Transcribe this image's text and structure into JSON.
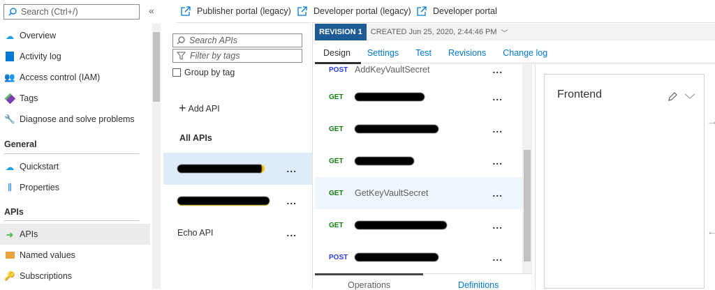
{
  "sidebar": {
    "search_placeholder": "Search (Ctrl+/)",
    "collapse": "«",
    "items": [
      {
        "label": "Overview"
      },
      {
        "label": "Activity log"
      },
      {
        "label": "Access control (IAM)"
      },
      {
        "label": "Tags"
      },
      {
        "label": "Diagnose and solve problems"
      }
    ],
    "general_title": "General",
    "general_items": [
      {
        "label": "Quickstart"
      },
      {
        "label": "Properties"
      }
    ],
    "apis_title": "APIs",
    "apis_items": [
      {
        "label": "APIs"
      },
      {
        "label": "Named values"
      },
      {
        "label": "Subscriptions"
      }
    ]
  },
  "portals": [
    {
      "label": "Publisher portal (legacy)"
    },
    {
      "label": "Developer portal (legacy)"
    },
    {
      "label": "Developer portal"
    }
  ],
  "api_list": {
    "search_placeholder": "Search APIs",
    "filter_placeholder": "Filter by tags",
    "group_by_tag": "Group by tag",
    "add_api": "Add API",
    "all_apis": "All APIs",
    "echo_api": "Echo API",
    "more": "..."
  },
  "revision": {
    "badge": "REVISION 1",
    "created": "CREATED Jun 25, 2020, 2:44:46 PM"
  },
  "tabs": [
    "Design",
    "Settings",
    "Test",
    "Revisions",
    "Change log"
  ],
  "operations": [
    {
      "method": "POST",
      "name": "AddKeyVaultSecret"
    },
    {
      "method": "GET"
    },
    {
      "method": "GET"
    },
    {
      "method": "GET"
    },
    {
      "method": "GET",
      "name": "GetKeyVaultSecret"
    },
    {
      "method": "GET"
    },
    {
      "method": "POST"
    }
  ],
  "bottom_tabs": {
    "operations": "Operations",
    "definitions": "Definitions"
  },
  "frontend": {
    "title": "Frontend"
  }
}
